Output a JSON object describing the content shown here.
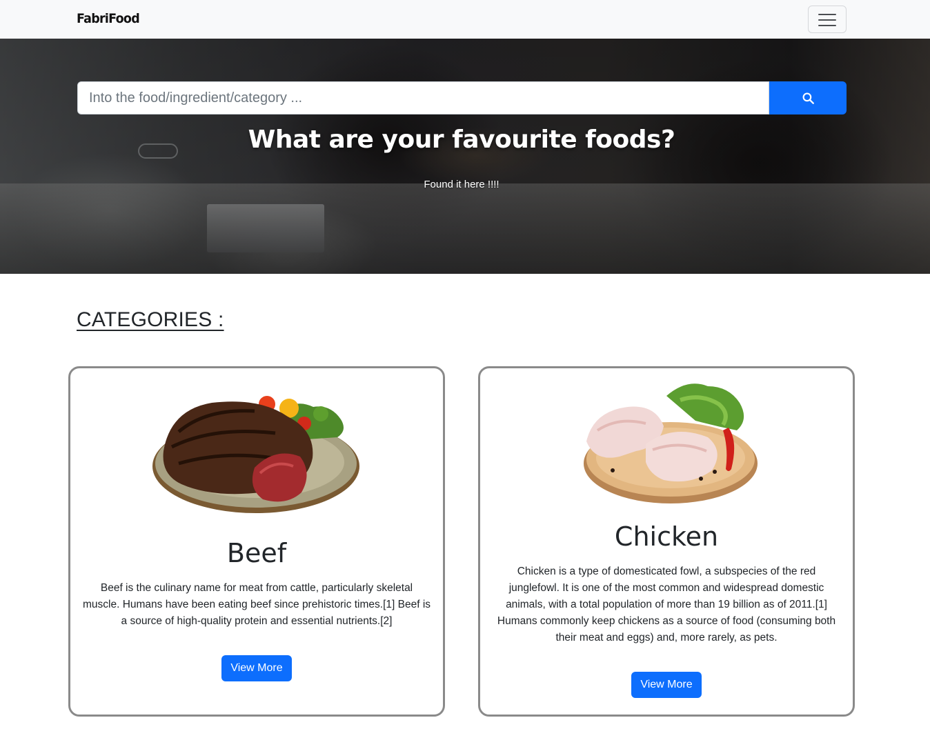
{
  "navbar": {
    "brand": "FabriFood",
    "toggler_icon": "hamburger-menu-icon"
  },
  "hero": {
    "search": {
      "placeholder": "Into the food/ingredient/category ...",
      "value": "",
      "button_icon": "search-icon"
    },
    "title": "What are your favourite foods?",
    "subtitle": "Found it here !!!!"
  },
  "categories": {
    "heading": "CATEGORIES :",
    "items": [
      {
        "title": "Beef",
        "description": "Beef is the culinary name for meat from cattle, particularly skeletal muscle. Humans have been eating beef since prehistoric times.[1] Beef is a source of high-quality protein and essential nutrients.[2]",
        "button": "View More"
      },
      {
        "title": "Chicken",
        "description": "Chicken is a type of domesticated fowl, a subspecies of the red junglefowl. It is one of the most common and widespread domestic animals, with a total population of more than 19 billion as of 2011.[1] Humans commonly keep chickens as a source of food (consuming both their meat and eggs) and, more rarely, as pets.",
        "button": "View More"
      }
    ]
  },
  "colors": {
    "primary": "#0d6efd",
    "navbar_bg": "#f8f9fa",
    "card_border": "#8a8a8a"
  }
}
